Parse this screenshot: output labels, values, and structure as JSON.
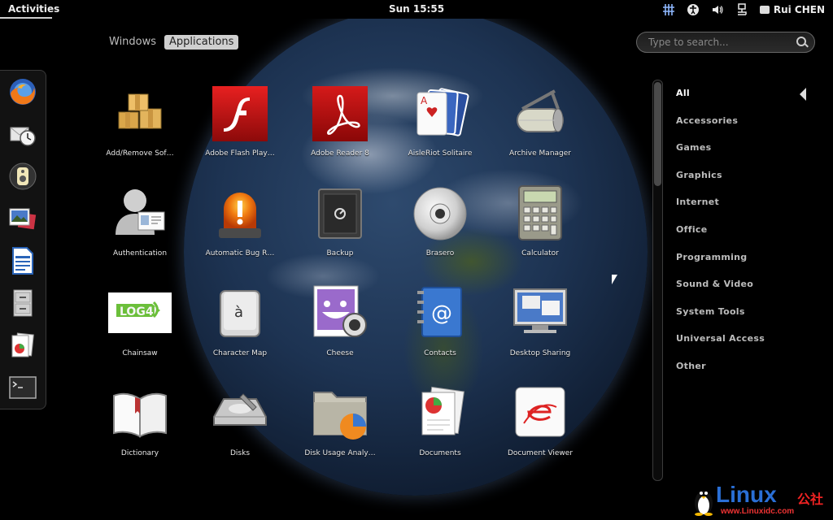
{
  "topbar": {
    "activities": "Activities",
    "clock": "Sun 15:55",
    "user": "Rui CHEN",
    "tray": [
      "input-grid-icon",
      "accessibility-icon",
      "volume-icon",
      "network-icon"
    ]
  },
  "view_tabs": {
    "windows": "Windows",
    "applications": "Applications",
    "active": "applications"
  },
  "search": {
    "placeholder": "Type to search..."
  },
  "dash": [
    "firefox-icon",
    "evolution-icon",
    "rhythmbox-icon",
    "image-viewer-icon",
    "writer-icon",
    "file-cabinet-icon",
    "documents-icon",
    "terminal-icon"
  ],
  "apps": [
    {
      "label": "Add/Remove Sof…",
      "icon": "package-boxes-icon"
    },
    {
      "label": "Adobe Flash Play…",
      "icon": "flash-icon"
    },
    {
      "label": "Adobe Reader 8",
      "icon": "adobe-reader-icon"
    },
    {
      "label": "AisleRiot Solitaire",
      "icon": "playing-cards-icon"
    },
    {
      "label": "Archive Manager",
      "icon": "archive-roller-icon"
    },
    {
      "label": "Authentication",
      "icon": "authentication-user-icon"
    },
    {
      "label": "Automatic Bug R…",
      "icon": "alarm-light-icon"
    },
    {
      "label": "Backup",
      "icon": "safe-icon"
    },
    {
      "label": "Brasero",
      "icon": "disc-icon"
    },
    {
      "label": "Calculator",
      "icon": "calculator-icon"
    },
    {
      "label": "Chainsaw",
      "icon": "log4j-icon"
    },
    {
      "label": "Character Map",
      "icon": "key-a-grave-icon"
    },
    {
      "label": "Cheese",
      "icon": "cheese-webcam-icon"
    },
    {
      "label": "Contacts",
      "icon": "address-book-icon"
    },
    {
      "label": "Desktop Sharing",
      "icon": "desktop-sharing-icon"
    },
    {
      "label": "Dictionary",
      "icon": "book-icon"
    },
    {
      "label": "Disks",
      "icon": "disk-utility-icon"
    },
    {
      "label": "Disk Usage Analy…",
      "icon": "folder-pie-icon"
    },
    {
      "label": "Documents",
      "icon": "documents-icon"
    },
    {
      "label": "Document Viewer",
      "icon": "document-viewer-icon"
    }
  ],
  "categories": [
    "All",
    "Accessories",
    "Games",
    "Graphics",
    "Internet",
    "Office",
    "Programming",
    "Sound & Video",
    "System Tools",
    "Universal Access",
    "Other"
  ],
  "selected_category": "All",
  "watermark": {
    "brand": "Linux",
    "brand_cn": "公社",
    "url": "www.Linuxidc.com"
  }
}
